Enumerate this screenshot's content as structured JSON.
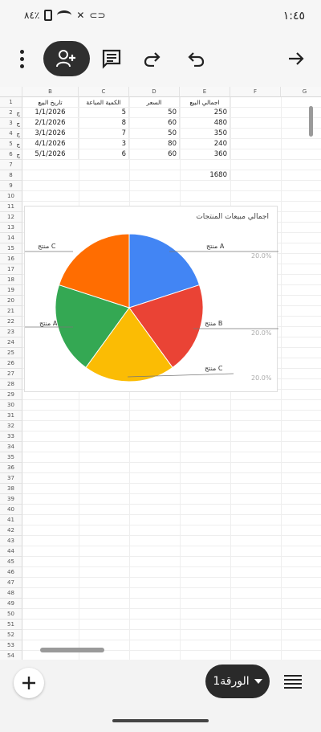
{
  "status": {
    "time": "١:٤٥",
    "battery_text": "٨٤٪"
  },
  "toolbar": {
    "more": "more",
    "share": "person-add",
    "comments": "comments",
    "redo": "redo",
    "undo": "undo",
    "forward": "arrow-right"
  },
  "sheet": {
    "columns": [
      "B",
      "C",
      "D",
      "E",
      "F",
      "G"
    ],
    "headers": [
      "تاريخ البيع",
      "الكمية المباعة",
      "السعر",
      "اجمالي البيع"
    ],
    "rows": [
      {
        "date": "1/1/2026",
        "qty": "5",
        "price": "50",
        "total": "250"
      },
      {
        "date": "2/1/2026",
        "qty": "8",
        "price": "60",
        "total": "480"
      },
      {
        "date": "3/1/2026",
        "qty": "7",
        "price": "50",
        "total": "350"
      },
      {
        "date": "4/1/2026",
        "qty": "3",
        "price": "80",
        "total": "240"
      },
      {
        "date": "5/1/2026",
        "qty": "6",
        "price": "60",
        "total": "360"
      }
    ],
    "grand_total": "1680",
    "a_stub": "منتج"
  },
  "chart_data": {
    "type": "pie",
    "title": "اجمالي مبيعات المنتجات",
    "categories": [
      "منتج A",
      "منتج B",
      "منتج C",
      "منتج A",
      "منتج C"
    ],
    "values": [
      20,
      20,
      20,
      20,
      20
    ],
    "percent_labels": [
      "20.0%",
      "20.0%",
      "20.0%"
    ],
    "colors": [
      "#4285F4",
      "#EA4335",
      "#FBBC04",
      "#34A853",
      "#FF6D01"
    ]
  },
  "bottom": {
    "sheet_name": "الورقة1"
  }
}
